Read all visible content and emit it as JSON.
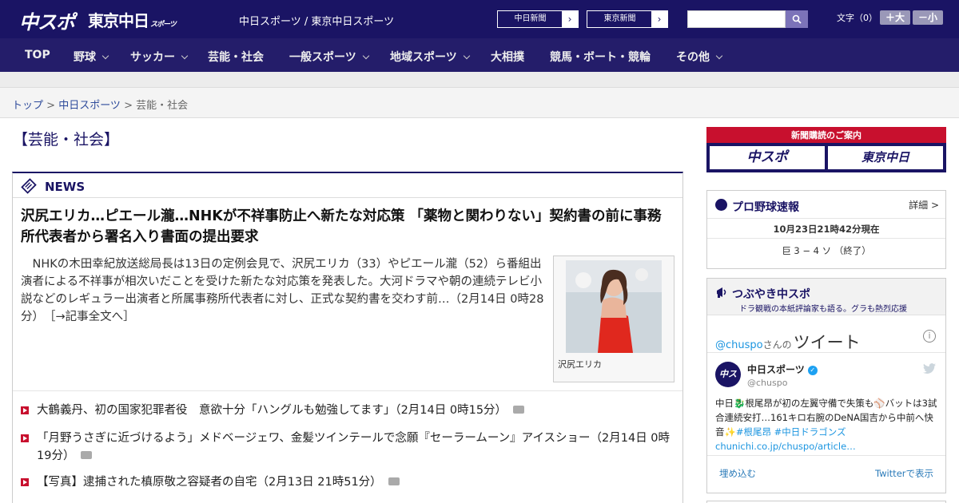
{
  "header": {
    "logo_chuspo": "中スポ",
    "logo_tokyo": "東京中日",
    "logo_tokyo_small": "スポーツ",
    "site_names": "中日スポーツ / 東京中日スポーツ",
    "btn_chunichi": "中日新聞",
    "btn_tokyo": "東京新聞",
    "search_placeholder": "",
    "text_size_label": "文字（0）",
    "font_larger": "＋大",
    "font_smaller": "－小",
    "colors": {
      "header_bg": "#1a1464",
      "nav_bg": "#241d6a",
      "accent_red": "#c8102e"
    }
  },
  "nav": {
    "items": [
      {
        "label": "TOP",
        "dropdown": false
      },
      {
        "label": "野球",
        "dropdown": true
      },
      {
        "label": "サッカー",
        "dropdown": true
      },
      {
        "label": "芸能・社会",
        "dropdown": false
      },
      {
        "label": "一般スポーツ",
        "dropdown": true
      },
      {
        "label": "地域スポーツ",
        "dropdown": true
      },
      {
        "label": "大相撲",
        "dropdown": false
      },
      {
        "label": "競馬・ボート・競輪",
        "dropdown": false
      },
      {
        "label": "その他",
        "dropdown": true
      }
    ]
  },
  "breadcrumb": {
    "home": "トップ",
    "sep": " > ",
    "section": "中日スポーツ",
    "current": "芸能・社会"
  },
  "main": {
    "page_title": "【芸能・社会】",
    "news_label": "NEWS",
    "lead": {
      "title": "沢尻エリカ…ピエール瀧…NHKが不祥事防止へ新たな対応策 「薬物と関わりない」契約書の前に事務所代表者から署名入り書面の提出要求",
      "body": "NHKの木田幸紀放送総局長は13日の定例会見で、沢尻エリカ（33）やピエール瀧（52）ら番組出演者による不祥事が相次いだことを受けた新たな対応策を発表した。大河ドラマや朝の連続テレビ小説などのレギュラー出演者と所属事務所代表者に対し、正式な契約書を交わす前…（2月14日 0時28分）",
      "more_link": "［→記事全文へ］",
      "photo_caption": "沢尻エリカ"
    },
    "list": [
      {
        "text": "大鶴義丹、初の国家犯罪者役　意欲十分「ハングルも勉強してます」（2月14日 0時15分）",
        "camera": true
      },
      {
        "text": "「月野うさぎに近づけるよう」メドベージェワ、金髪ツインテールで念願『セーラームーン』アイスショー（2月14日 0時19分）",
        "camera": true
      },
      {
        "text": "【写真】逮捕された槙原敬之容疑者の自宅（2月13日 21時51分）",
        "camera": true
      }
    ]
  },
  "sidebar": {
    "ad_head": "新聞購読のご案内",
    "ad_logo1": "中スポ",
    "ad_logo2": "東京中日",
    "baseball": {
      "title": "プロ野球速報",
      "more": "詳細 >",
      "time": "10月23日21時42分現在",
      "score": "巨 3 − 4 ソ （終了）"
    },
    "tweets": {
      "title": "つぶやき中スポ",
      "subtitle": "ドラ観戦の本紙評論家も語る。グラも熱烈応援",
      "handle": "@chuspo",
      "handle_suffix": "さんの",
      "heading": "ツイート",
      "account_name": "中日スポーツ",
      "account_user": "@chuspo",
      "avatar_text": "中スポ",
      "tweet_text": "中日🐉根尾昂が初の左翼守備で失策も⚾バットは3試合連続安打…161キロ右腕のDeNA国吉から中前へ快音✨",
      "hashtags": "#根尾昂 #中日ドラゴンズ",
      "link": "chunichi.co.jp/chuspo/article…",
      "embed": "埋め込む",
      "view_on": "Twitterで表示"
    }
  }
}
